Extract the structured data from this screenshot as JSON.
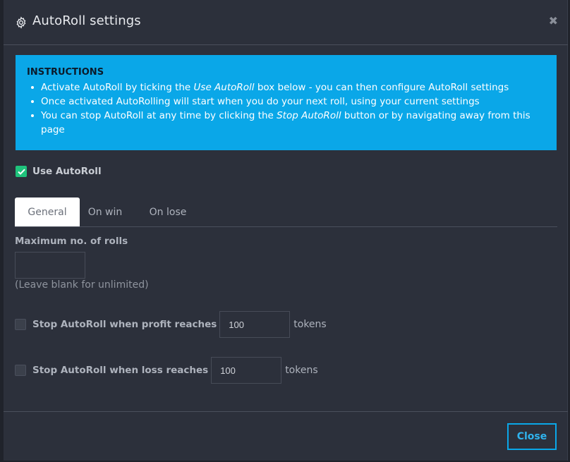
{
  "dialog": {
    "title": "AutoRoll settings",
    "close_symbol": "✖"
  },
  "instructions": {
    "title": "INSTRUCTIONS",
    "items": [
      {
        "pre": "Activate AutoRoll by ticking the ",
        "em": "Use AutoRoll",
        "post": " box below - you can then configure AutoRoll settings"
      },
      {
        "pre": "Once activated AutoRolling will start when you do your next roll, using your current settings",
        "em": "",
        "post": ""
      },
      {
        "pre": "You can stop AutoRoll at any time by clicking the ",
        "em": "Stop AutoRoll",
        "post": " button or by navigating away from this page"
      }
    ]
  },
  "use_autoroll": {
    "label": "Use AutoRoll",
    "checked": true
  },
  "tabs": [
    {
      "label": "General",
      "active": true
    },
    {
      "label": "On win",
      "active": false
    },
    {
      "label": "On lose",
      "active": false
    }
  ],
  "general": {
    "max_rolls_label": "Maximum no. of rolls",
    "max_rolls_value": "",
    "max_rolls_help": "(Leave blank for unlimited)",
    "stop_profit": {
      "label": "Stop AutoRoll when profit reaches",
      "value": "100",
      "unit": "tokens",
      "checked": false
    },
    "stop_loss": {
      "label": "Stop AutoRoll when loss reaches",
      "value": "100",
      "unit": "tokens",
      "checked": false
    }
  },
  "footer": {
    "close_label": "Close"
  },
  "colors": {
    "accent": "#0aa7e8",
    "check_green": "#1fc37c",
    "modal_bg": "#2c303b"
  }
}
